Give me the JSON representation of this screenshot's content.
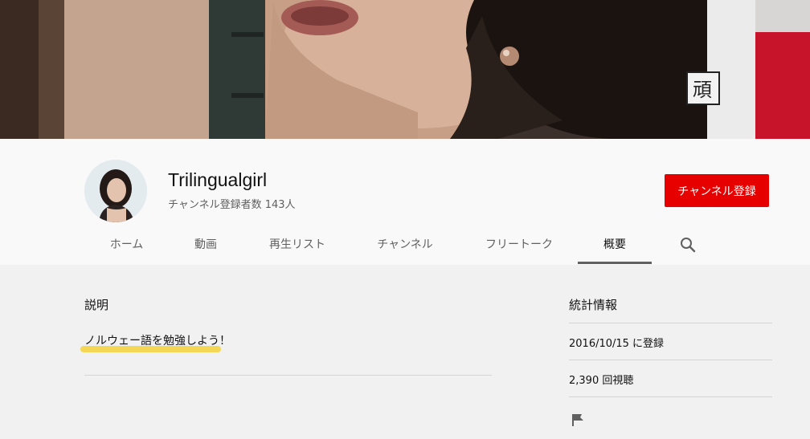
{
  "channel": {
    "name": "Trilingualgirl",
    "subscribers": "チャンネル登録者数 143人",
    "subscribe_label": "チャンネル登録"
  },
  "tabs": [
    {
      "label": "ホーム",
      "active": false
    },
    {
      "label": "動画",
      "active": false
    },
    {
      "label": "再生リスト",
      "active": false
    },
    {
      "label": "チャンネル",
      "active": false
    },
    {
      "label": "フリートーク",
      "active": false
    },
    {
      "label": "概要",
      "active": true
    }
  ],
  "about": {
    "description_heading": "説明",
    "description_text": "ノルウェー語を勉強しよう！",
    "stats_heading": "統計情報",
    "joined": "2016/10/15 に登録",
    "views": "2,390 回視聴"
  },
  "icons": {
    "search": "search-icon",
    "flag": "flag-icon"
  },
  "colors": {
    "subscribe": "#e60000",
    "highlight": "#f5d33a"
  }
}
